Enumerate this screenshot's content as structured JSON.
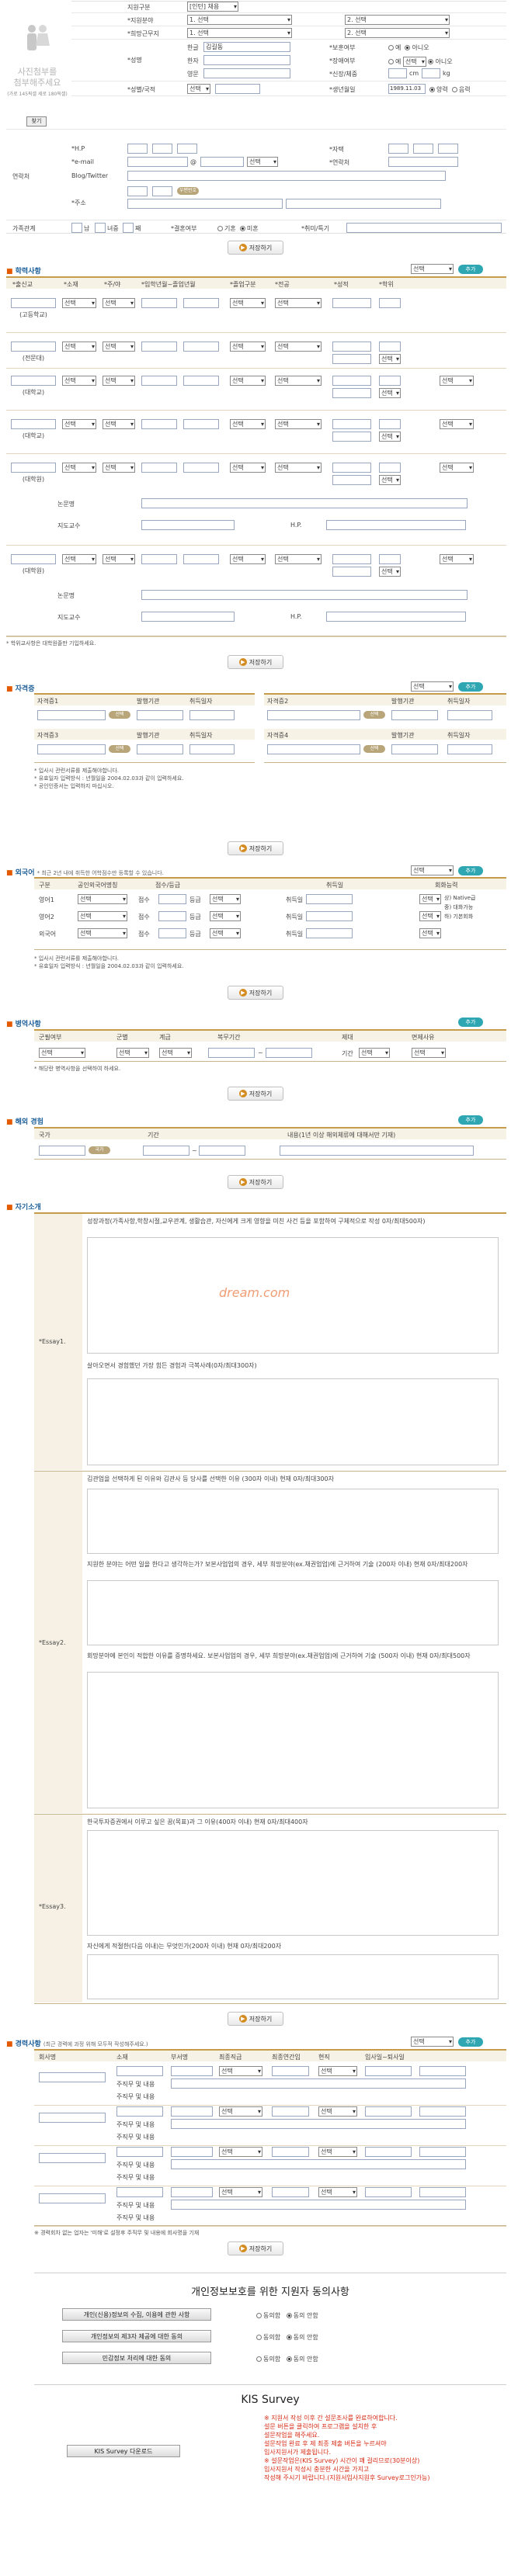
{
  "photo": {
    "line1": "사진첨부를",
    "line2": "첨부해주세요",
    "btn": "찾기",
    "note": "(가로 145픽셀 세로 180픽셀)"
  },
  "personal": {
    "rows": [
      {
        "label": "지원구분",
        "value": "[인턴] 채용"
      },
      {
        "label": "*지원분야",
        "sel1": "1. 선택",
        "sel2": "2. 선택"
      },
      {
        "label": "*희망근무지",
        "sel1": "1. 선택",
        "sel2": "2. 선택"
      }
    ],
    "name_label": "*성명",
    "kor": "한글",
    "kor_val": "김길동",
    "han": "한자",
    "eng": "영문",
    "mil_label": "*보훈여부",
    "mil_opts": [
      "예",
      "아니오"
    ],
    "dis_label": "*장애여부",
    "dis_opts": [
      "예",
      "아니오"
    ],
    "height_label": "*신장/체중",
    "height_unit": "cm",
    "weight_unit": "kg",
    "birth_label": "*성별/국적",
    "birth2_label": "*생년월일",
    "birth_val": "1989.11.03",
    "cal_opts": [
      "양력",
      "음력"
    ],
    "hp": "*H.P",
    "tel": "*자택",
    "email": "*e-mail",
    "email_sel": "선택",
    "blog": "Blog/Twitter",
    "emerg": "*연락처",
    "addr": "*주소",
    "zip_btn": "우편번호",
    "family": "가족관계",
    "family_cnt": "남",
    "family_cnt2": "녀중",
    "family_nth": "째",
    "marr": "*결혼여부",
    "marr_opts": [
      "기혼",
      "미혼"
    ],
    "hobby": "*취미/특기",
    "contact_group": "연락처"
  },
  "save_label": "저장하기",
  "add_label": "추가",
  "sel_label": "선택",
  "edu": {
    "title": "학력사항",
    "headers": [
      "*출신교",
      "*소재",
      "*주/야",
      "*입학년월~졸업년월",
      "*졸업구분",
      "*전공",
      "*성적",
      "*학위"
    ],
    "rows": [
      "(고등학교)",
      "(전문대)",
      "(대학교)",
      "(대학교)",
      "(대학원)",
      "(대학원)"
    ],
    "thesis": "논문명",
    "prof": "지도교수",
    "hp": "H.P.",
    "note": "* 학위교사항은 대학원졸만 기입하세요."
  },
  "cert": {
    "title": "자격증",
    "headers": [
      "자격증1",
      "발행기관",
      "취득일자",
      "자격증2",
      "발행기관",
      "취득일자"
    ],
    "headers2": [
      "자격증3",
      "발행기관",
      "취득일자",
      "자격증4",
      "발행기관",
      "취득일자"
    ],
    "notes": [
      "* 입사시 관련서류를 제출해야합니다.",
      "* 유효일자 입력방식 : 년월일을 2004.02.03과 같이 입력하세요.",
      "* 공인인증서는 입력하지 마십시오."
    ]
  },
  "lang": {
    "title": "외국어",
    "subtitle": "* 최근 2년 내에 취득한 어학점수만 등록할 수 있습니다.",
    "headers": [
      "구분",
      "공인외국어명칭",
      "점수/등급",
      "취득일",
      "회화능력"
    ],
    "rows": [
      "영어1",
      "영어2",
      "외국어"
    ],
    "score": "점수",
    "grade": "등급",
    "date": "취득일",
    "speak_opts": [
      "상) Native급",
      "중) 대화가능",
      "하) 기본회화"
    ],
    "notes": [
      "* 입사시 관련서류를 제출해야합니다.",
      "* 유효일자 입력방식 : 년월일을 2004.02.03과 같이 입력하세요."
    ]
  },
  "military": {
    "title": "병역사항",
    "headers": [
      "군필여부",
      "군별",
      "계급",
      "복무기간",
      "제대",
      "면제사유"
    ],
    "period_sep": "~",
    "mil_sel": "선택",
    "mil_unit": "기간",
    "note": "* 해당란 병역사항을 선택하여 하세요."
  },
  "abroad": {
    "title": "해외 경험",
    "headers": [
      "국가",
      "기간",
      "내용(1년 이상 해외체류에 대해서만 기재)"
    ],
    "btn": "국가"
  },
  "essay": {
    "title": "자기소개",
    "items": [
      {
        "label": "*Essay1.",
        "q1": "성장과정(가족사항,학창시절,교우관계, 생활습관, 자신에게 크게 영향을 미친 사건 등을 포함하여 구체적으로 작성 0자/최대500자)",
        "q2": "살아오면서 경험했던 가장 힘든 경험과 극복사례(0자/최대300자)"
      },
      {
        "label": "*Essay2.",
        "q1": "김관업을 선택하게 된 이유와 김관사 등 당사를 선택한 이유 (300자 이내) 현재 0자/최대300자",
        "q2": "지원한 분야는 어떤 일을 한다고 생각하는가? 보본사업업의 경우, 세부 희망분야(ex.채권업업)에 근거하여 기술 (200자 이내) 현재 0자/최대200자",
        "q3": "회망분야에 본인이 적합한 이유를 증명하세요. 보본사업업의 경우, 세부 희망분야(ex.채권업업)에 근거하여 기술 (500자 이내) 현재 0자/최대500자"
      },
      {
        "label": "*Essay3.",
        "q1": "한국투자증권에서 이루고 싶은 꿈(목표)과 그 이유(400자 이내) 현재 0자/최대400자",
        "q2": "자신에게 적절한(다음 이내)는 무엇인가(200자 이내) 현재 0자/최대200자"
      }
    ],
    "watermark": "dream.com"
  },
  "career": {
    "title": "경력사항",
    "subtitle": "(최근 경력에 과정 위해 모두적 작성해주세요.)",
    "headers": [
      "회사명",
      "소재",
      "부서명",
      "최종직급",
      "최종연간임",
      "현직",
      "입사일~퇴사일"
    ],
    "sub": "주직무 및 내용",
    "note": "※ 경력회차 없는 업자는 '미해'로 설정후 주직무 및 내용에 회사명을 기재"
  },
  "privacy": {
    "title": "개인정보보호를 위한 지원자 동의사항",
    "items": [
      "개인(신용)정보의 수집, 이용에 관한 사항",
      "개인정보의 제3자 제공에 대한 동의",
      "민감정보 처리에 대한 동의"
    ],
    "opts": [
      "동의함",
      "동의 안함"
    ]
  },
  "survey": {
    "title": "KIS Survey",
    "btn": "KIS Survey 다운로드",
    "lines": [
      "※ 지원서 작성 이후 간 설문조사를 완료하여합니다.",
      "설문 버튼을 클릭하여 프로그램을 설치한 후",
      "설문작업을 해주세요.",
      "설문작업 완료 후 제 최종 제출 버튼을 누르셔야",
      "입사지원서가 제출됩니다.",
      "※ 설문작업은(KIS Survey) 시간이 꽤 걸리므로(30분이상)",
      "입사지원서 작성시 충분한 시간을 가지고",
      "작성해 주시기 바랍니다.(지원서입사지원후 Survey로그인가능)"
    ]
  },
  "colors": {
    "accent": "#1d5f99",
    "orange": "#e35a00",
    "teal": "#2ea7b3",
    "gold": "#c69b4a"
  }
}
